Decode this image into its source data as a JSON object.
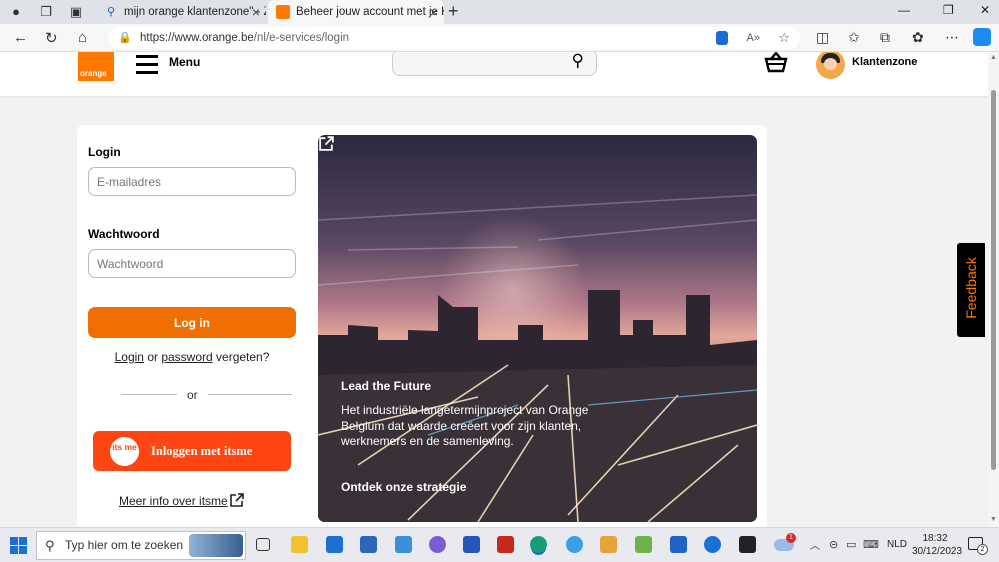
{
  "browser": {
    "tabs": [
      {
        "title": "mijn orange klantenzone\" - Zoek",
        "active": false
      },
      {
        "title": "Beheer jouw account met je Klan",
        "active": true
      }
    ],
    "url": {
      "host": "https://www.orange.be",
      "path": "/nl/e-services/login"
    }
  },
  "header": {
    "logo_text": "orange",
    "menu_label": "Menu",
    "search_placeholder": "",
    "account_label": "Klantenzone"
  },
  "login": {
    "email_label": "Login",
    "email_placeholder": "E-mailadres",
    "password_label": "Wachtwoord",
    "password_placeholder": "Wachtwoord",
    "login_button": "Log in",
    "forgot_login": "Login",
    "forgot_or": "or",
    "forgot_password": "password",
    "forgot_suffix": "vergeten?",
    "divider_text": "or",
    "itsme_logo_text": "its me",
    "itsme_button": "Inloggen met itsme",
    "itsme_info": "Meer info over itsme"
  },
  "hero": {
    "title": "Lead the Future",
    "text": "Het industriële langetermijnproject van Orange Belgium dat waarde creëert voor zijn klanten, werknemers en de samenleving.",
    "link": "Ontdek onze strategie"
  },
  "feedback_label": "Feedback",
  "taskbar": {
    "search_placeholder": "Typ hier om te zoeken",
    "language": "NLD",
    "time": "18:32",
    "date": "30/12/2023",
    "weather_badge": "1",
    "notification_count": "2"
  },
  "colors": {
    "orange": "#ff7900",
    "button": "#f16e00",
    "itsme": "#ff4612"
  }
}
